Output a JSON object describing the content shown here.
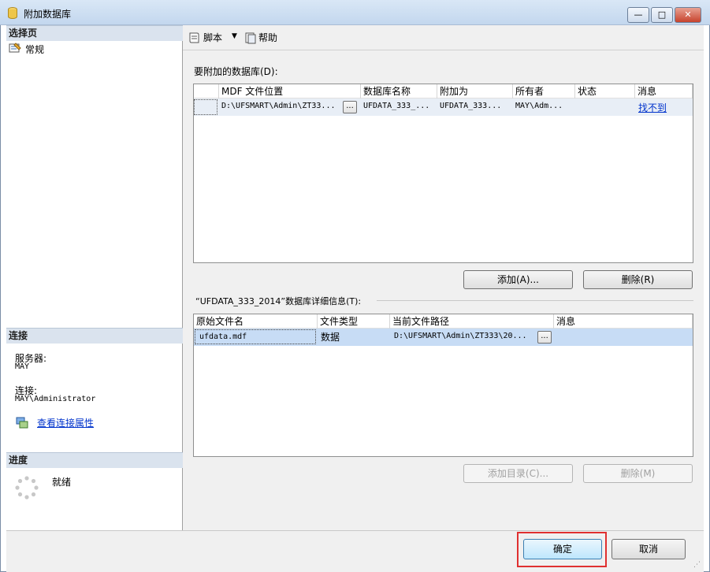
{
  "window": {
    "title": "附加数据库",
    "buttons": [
      "—",
      "□",
      "✕"
    ]
  },
  "left": {
    "select_page_header": "选择页",
    "pages": [
      {
        "label": "常规"
      }
    ],
    "connection_header": "连接",
    "server_label": "服务器:",
    "server_value": "MAY",
    "connection_label": "连接:",
    "connection_value": "MAY\\Administrator",
    "view_props_link": "查看连接属性",
    "progress_header": "进度",
    "progress_status": "就绪"
  },
  "toolbar": {
    "script_label": "脚本",
    "help_label": "帮助"
  },
  "attach_grid": {
    "label": "要附加的数据库(D):",
    "headers": [
      "MDF 文件位置",
      "数据库名称",
      "附加为",
      "所有者",
      "状态",
      "消息"
    ],
    "row": {
      "mdf": "D:\\UFSMART\\Admin\\ZT33...",
      "db_name": "UFDATA_333_...",
      "attach_as": "UFDATA_333...",
      "owner": "MAY\\Adm...",
      "status": "",
      "message": "找不到"
    },
    "add_button": "添加(A)...",
    "remove_button": "删除(R)"
  },
  "details": {
    "label": "“UFDATA_333_2014”数据库详细信息(T):",
    "headers": [
      "原始文件名",
      "文件类型",
      "当前文件路径",
      "消息"
    ],
    "row": {
      "file": "ufdata.mdf",
      "type": "数据",
      "path": "D:\\UFSMART\\Admin\\ZT333\\20...",
      "message": ""
    },
    "add_catalog_button": "添加目录(C)...",
    "remove_button": "删除(M)"
  },
  "footer": {
    "ok_button": "确定",
    "cancel_button": "取消"
  },
  "colors": {
    "selected_row": "#c7dcf5",
    "highlight_box": "#e03030",
    "link": "#0033cc"
  }
}
